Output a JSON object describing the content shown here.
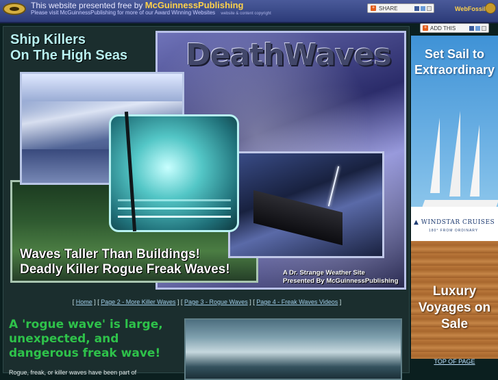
{
  "banner": {
    "line1_prefix": "This website presented free by",
    "line1_brand": "McGuinnessPublishing",
    "line2": "Please visit McGuinnessPublishing for more of our Award Winning Websites",
    "copyright": "website & content copyright",
    "share_label": "SHARE",
    "webfossil": "WebFossil"
  },
  "hero": {
    "title_line1": "Ship Killers",
    "title_line2": "On The High Seas",
    "logo_text": "DeathWaves",
    "caption_line1": "Waves Taller Than Buildings!",
    "caption_line2": "Deadly Killer Rogue Freak Waves!",
    "credit_line1": "A Dr. Strange Weather Site",
    "credit_line2": "Presented By McGuinnessPublishing"
  },
  "nav": {
    "items": [
      "Home",
      "Page 2 - More Killer Waves",
      "Page 3 - Rogue Waves",
      "Page 4 - Freak Waves Videos"
    ]
  },
  "article": {
    "heading": "A 'rogue wave' is large, unexpected, and dangerous freak wave!",
    "body": "Rogue, freak, or killer waves have been part of"
  },
  "sidebar": {
    "addthis_label": "ADD THIS",
    "ad_headline": "Set Sail to Extraordinary",
    "ad_brand": "WINDSTAR CRUISES",
    "ad_brand_sub": "180° FROM ORDINARY",
    "ad_bottom": "Luxury Voyages on Sale",
    "top_of_page": "TOP OF PAGE"
  },
  "colors": {
    "background": "#0b1f1f",
    "banner": "#2c3b78",
    "heading_green": "#2ec24a",
    "link": "#9ecbe6"
  }
}
